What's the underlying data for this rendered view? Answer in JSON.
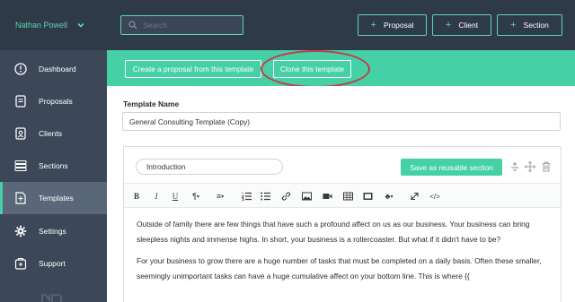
{
  "sidebar": {
    "user_name": "Nathan Powell",
    "items": [
      {
        "label": "Dashboard",
        "icon": "dashboard-icon"
      },
      {
        "label": "Proposals",
        "icon": "proposals-icon"
      },
      {
        "label": "Clients",
        "icon": "clients-icon"
      },
      {
        "label": "Sections",
        "icon": "sections-icon"
      },
      {
        "label": "Templates",
        "icon": "templates-icon",
        "active": true
      },
      {
        "label": "Settings",
        "icon": "gear-icon"
      },
      {
        "label": "Support",
        "icon": "support-icon"
      }
    ]
  },
  "topbar": {
    "search_placeholder": "Search",
    "buttons": [
      {
        "label": "Proposal"
      },
      {
        "label": "Client"
      },
      {
        "label": "Section"
      }
    ]
  },
  "actionbar": {
    "create_label": "Create a proposal from this template",
    "clone_label": "Clone this template"
  },
  "template": {
    "name_label": "Template Name",
    "name_value": "General Consulting Template (Copy)"
  },
  "editor": {
    "section_name": "Introduction",
    "save_reusable_label": "Save as reusable section",
    "toolbar_icons": [
      "bold-icon",
      "italic-icon",
      "underline-icon",
      "paragraph-icon",
      "align-icon",
      "ordered-list-icon",
      "unordered-list-icon",
      "link-icon",
      "image-icon",
      "video-icon",
      "table-icon",
      "embed-icon",
      "format-icon",
      "fullscreen-icon",
      "code-icon"
    ],
    "paragraphs": [
      "Outside of family there are few things that have such a profound affect on us as our business. Your business can bring sleepless nights and immense highs. In short, your business is a rollercoaster. But what if it didn't have to be?",
      "For your business to grow there are a huge number of tasks that must be completed on a daily basis. Often these smaller, seemingly unimportant tasks can have a huge cumulative affect on your bottom line. This is where {{"
    ]
  },
  "colors": {
    "accent": "#45d0a6",
    "sidebar": "#3c4858",
    "topbar": "#2f3a48",
    "highlight_ring": "#c83a4b"
  }
}
